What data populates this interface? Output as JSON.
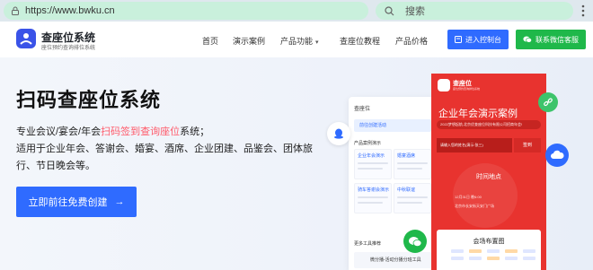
{
  "browser": {
    "url": "https://www.bwku.cn",
    "search_placeholder": "搜索"
  },
  "header": {
    "logo_title": "查座位系统",
    "logo_subtitle": "座位预约查询排位系统",
    "nav": [
      {
        "label": "首页"
      },
      {
        "label": "演示案例"
      },
      {
        "label": "产品功能"
      },
      {
        "label": "查座位教程"
      },
      {
        "label": "产品价格"
      }
    ],
    "console_button": "进入控制台",
    "wechat_button": "联系微信客服"
  },
  "hero": {
    "title": "扫码查座位系统",
    "desc_part1": "专业会议/宴会/年会",
    "desc_highlight": "扫码签到查询座位",
    "desc_part2": "系统；",
    "desc_line2": "适用于企业年会、答谢会、婚宴、酒席、企业团建、品鉴会、团体旅行、节日晚会等。",
    "cta": "立即前往免费创建",
    "cta_arrow": "→"
  },
  "admin_panel": {
    "title": "查座位",
    "create": "前往创建活动",
    "section_cases": "产品案例演示",
    "cards": [
      {
        "title": "企业年会演示"
      },
      {
        "title": "婚宴酒席"
      },
      {
        "title": "骑车答谢会演示"
      },
      {
        "title": "中秋联谊"
      }
    ],
    "section_tools": "更多工具推荐",
    "bottom_item": "微分播-活动分播分班工具"
  },
  "phone": {
    "brand": "查座位",
    "brand_sub": "座位预约查询排位系统",
    "hero_title": "企业年会演示案例",
    "pill": "2022梦想起航,北京优查座位科技有限公司招商年会!",
    "input_placeholder": "请输入您的姓名(演示:张三)",
    "sign_button": "签到",
    "time_place": "时间地点",
    "date": "12月31日 晚6:00",
    "address": "北京市长安街天安门广场",
    "layout_title": "会场布置图"
  },
  "colors": {
    "primary": "#2f6bff",
    "wechat": "#1fb84a",
    "highlight": "#ff5a6a",
    "phone_red": "#e8332f"
  }
}
